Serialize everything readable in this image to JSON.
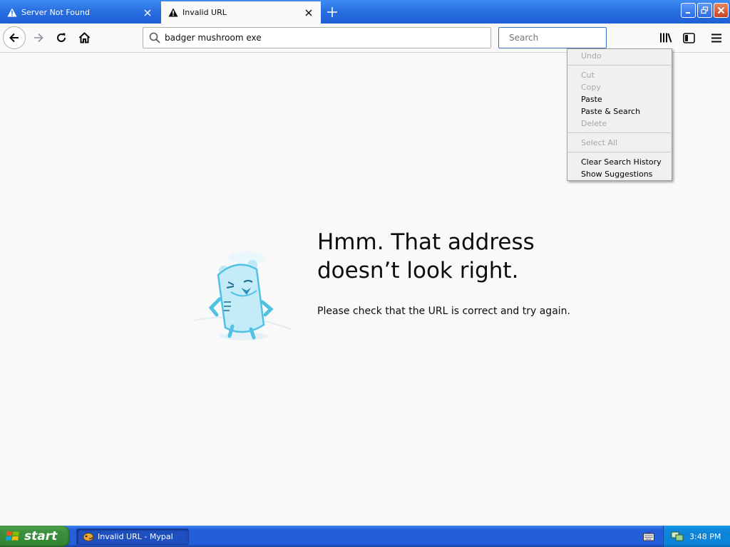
{
  "tabs": [
    {
      "label": "Server Not Found",
      "active": false
    },
    {
      "label": "Invalid URL",
      "active": true
    }
  ],
  "urlbar": {
    "value": "badger mushroom exe"
  },
  "searchbar": {
    "placeholder": "Search"
  },
  "context_menu": {
    "items": [
      {
        "label": "Undo",
        "enabled": false
      },
      {
        "label": "Cut",
        "enabled": false
      },
      {
        "label": "Copy",
        "enabled": false
      },
      {
        "label": "Paste",
        "enabled": true
      },
      {
        "label": "Paste & Search",
        "enabled": true
      },
      {
        "label": "Delete",
        "enabled": false
      },
      {
        "label": "Select All",
        "enabled": false
      },
      {
        "label": "Clear Search History",
        "enabled": true
      },
      {
        "label": "Show Suggestions",
        "enabled": true
      }
    ]
  },
  "error_page": {
    "title_line1": "Hmm. That address",
    "title_line2": "doesn’t look right.",
    "description": "Please check that the URL is correct and try again."
  },
  "taskbar": {
    "start_label": "start",
    "task_label": "Invalid URL - Mypal",
    "clock": "3:48 PM"
  },
  "colors": {
    "titlebar": "#2a6fe0",
    "page_background": "#f9f9fa",
    "taskbar": "#245edb",
    "start_button": "#3c8f3c",
    "illustration": "#8fd8f0"
  }
}
